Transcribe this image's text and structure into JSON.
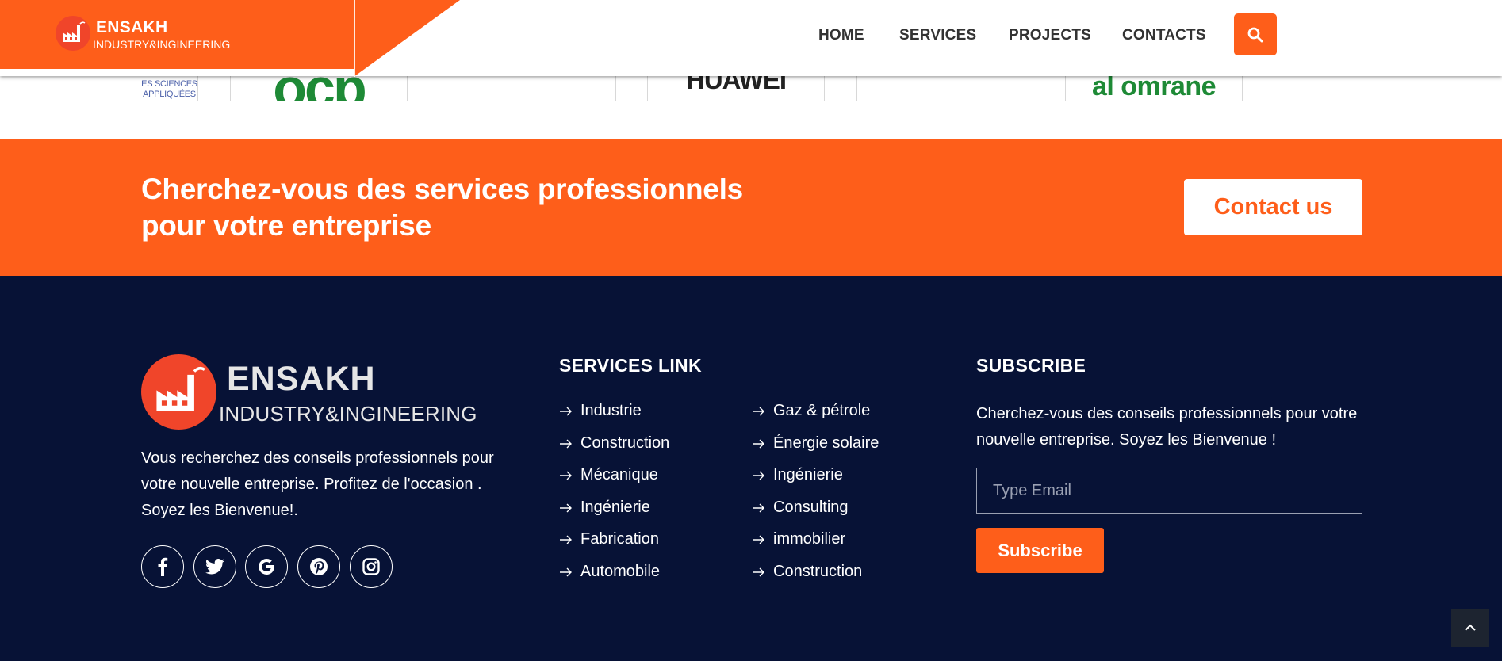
{
  "brand": {
    "name": "ENSAKH",
    "subtitle": "INDUSTRY&INGINEERING"
  },
  "nav": {
    "items": [
      {
        "label": "HOME"
      },
      {
        "label": "SERVICES"
      },
      {
        "label": "PROJECTS"
      },
      {
        "label": "CONTACTS"
      }
    ],
    "search_icon": "search-icon"
  },
  "partners": {
    "logos": [
      {
        "text": "ES SCIENCES\nAPPLIQUÉES"
      },
      {
        "text": "ocp"
      },
      {
        "text": ""
      },
      {
        "text": "HUAWEI"
      },
      {
        "text": ""
      },
      {
        "text": "al omrane"
      },
      {
        "text": ""
      }
    ]
  },
  "cta": {
    "title": "Cherchez-vous des services professionnels pour votre entreprise",
    "button": "Contact us"
  },
  "footer": {
    "brand_name": "ENSAKH",
    "brand_subtitle": "INDUSTRY&INGINEERING",
    "description": "Vous recherchez des conseils professionnels pour votre nouvelle entreprise. Profitez de l'occasion . Soyez les Bienvenue!.",
    "social": [
      "facebook-icon",
      "twitter-icon",
      "google-icon",
      "pinterest-icon",
      "instagram-icon"
    ],
    "services": {
      "title": "SERVICES LINK",
      "col1": [
        "Industrie",
        "Construction",
        "Mécanique",
        "Ingénierie",
        "Fabrication",
        "Automobile"
      ],
      "col2": [
        "Gaz & pétrole",
        "Énergie solaire",
        "Ingénierie",
        "Consulting",
        "immobilier",
        "Construction"
      ]
    },
    "subscribe": {
      "title": "SUBSCRIBE",
      "description": "Cherchez-vous des conseils professionnels pour votre nouvelle entreprise. Soyez les Bienvenue !",
      "email_placeholder": "Type Email",
      "button": "Subscribe"
    }
  },
  "colors": {
    "accent": "#fe5e1a",
    "footer_bg": "#071236",
    "text_dark": "#333333"
  }
}
